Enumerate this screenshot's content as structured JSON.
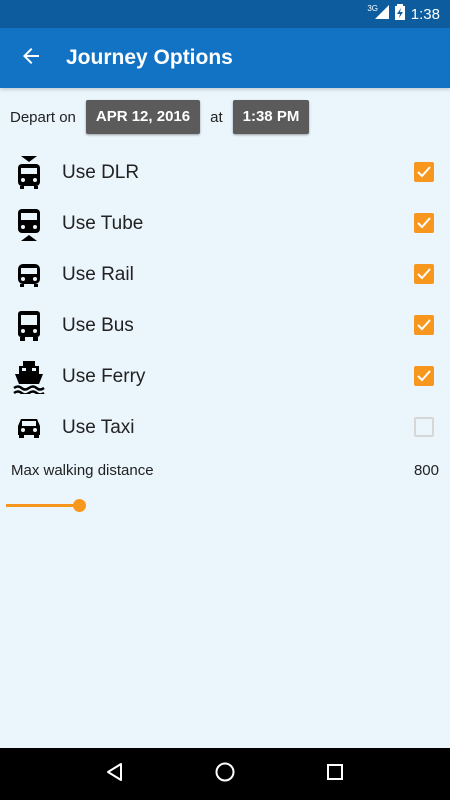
{
  "status_bar": {
    "time": "1:38",
    "network": "3G",
    "battery_icon": "battery-charging-icon",
    "signal_icon": "signal-icon"
  },
  "app_bar": {
    "title": "Journey Options",
    "back_icon": "arrow-back-icon"
  },
  "depart": {
    "label": "Depart on",
    "date": "APR 12, 2016",
    "at_label": "at",
    "time": "1:38 PM"
  },
  "options": [
    {
      "label": "Use DLR",
      "icon": "dlr-train-icon",
      "checked": true
    },
    {
      "label": "Use Tube",
      "icon": "tube-train-icon",
      "checked": true
    },
    {
      "label": "Use Rail",
      "icon": "rail-train-icon",
      "checked": true
    },
    {
      "label": "Use Bus",
      "icon": "bus-icon",
      "checked": true
    },
    {
      "label": "Use Ferry",
      "icon": "ferry-icon",
      "checked": true
    },
    {
      "label": "Use Taxi",
      "icon": "taxi-icon",
      "checked": false
    }
  ],
  "walking": {
    "label": "Max walking distance",
    "value": "800",
    "slider_fraction": 0.167
  },
  "colors": {
    "accent": "#f7971e",
    "app_bar": "#1272c4",
    "status_bar": "#0d5d9e",
    "background": "#eaf5fc",
    "chip": "#5b5b5b"
  },
  "nav_bar": {
    "back_icon": "nav-back-icon",
    "home_icon": "nav-home-icon",
    "recents_icon": "nav-recents-icon"
  }
}
